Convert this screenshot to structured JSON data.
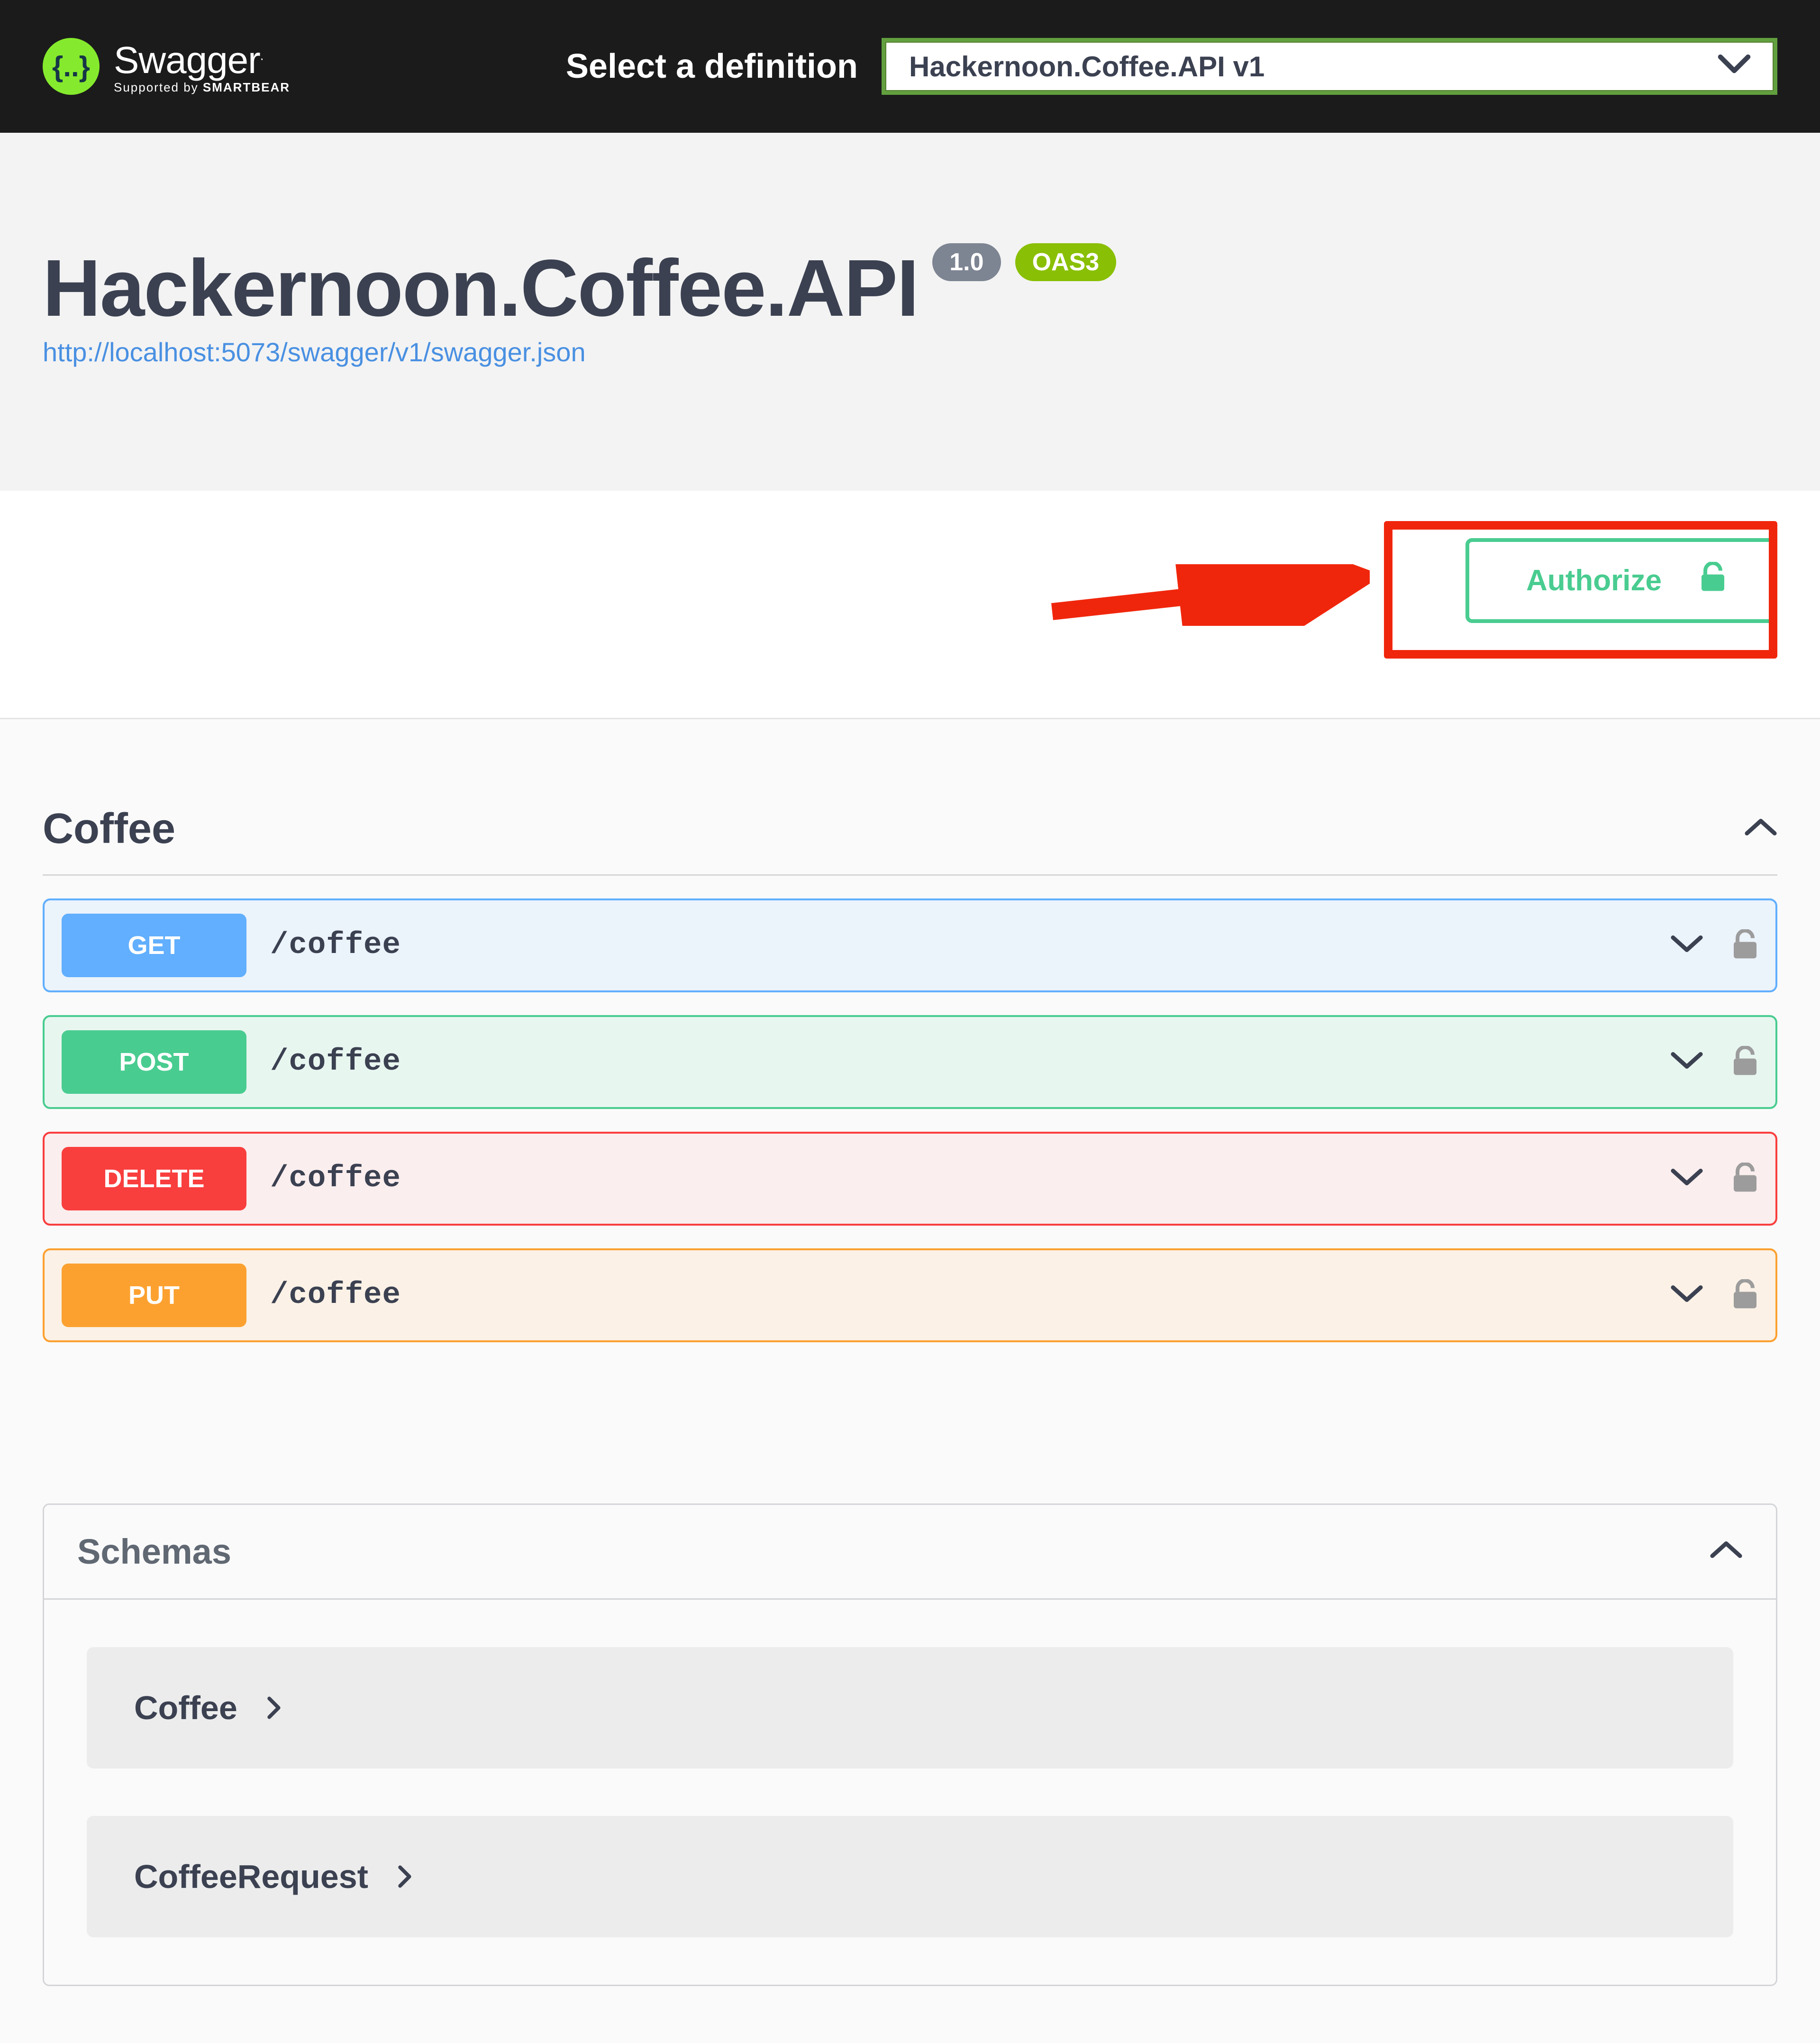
{
  "topbar": {
    "brand_main": "Swagger",
    "brand_sub_prefix": "Supported by ",
    "brand_sub_brand": "SMARTBEAR",
    "select_label": "Select a definition",
    "selected_definition": "Hackernoon.Coffee.API v1"
  },
  "info": {
    "title": "Hackernoon.Coffee.API",
    "version": "1.0",
    "oas_badge": "OAS3",
    "spec_url": "http://localhost:5073/swagger/v1/swagger.json"
  },
  "auth": {
    "authorize_label": "Authorize"
  },
  "tag": {
    "name": "Coffee",
    "operations": [
      {
        "method": "GET",
        "path": "/coffee",
        "css": "op-get"
      },
      {
        "method": "POST",
        "path": "/coffee",
        "css": "op-post"
      },
      {
        "method": "DELETE",
        "path": "/coffee",
        "css": "op-delete"
      },
      {
        "method": "PUT",
        "path": "/coffee",
        "css": "op-put"
      }
    ]
  },
  "schemas": {
    "title": "Schemas",
    "items": [
      "Coffee",
      "CoffeeRequest"
    ]
  },
  "colors": {
    "accent_green": "#49cc90",
    "annotation_red": "#f0260c"
  }
}
